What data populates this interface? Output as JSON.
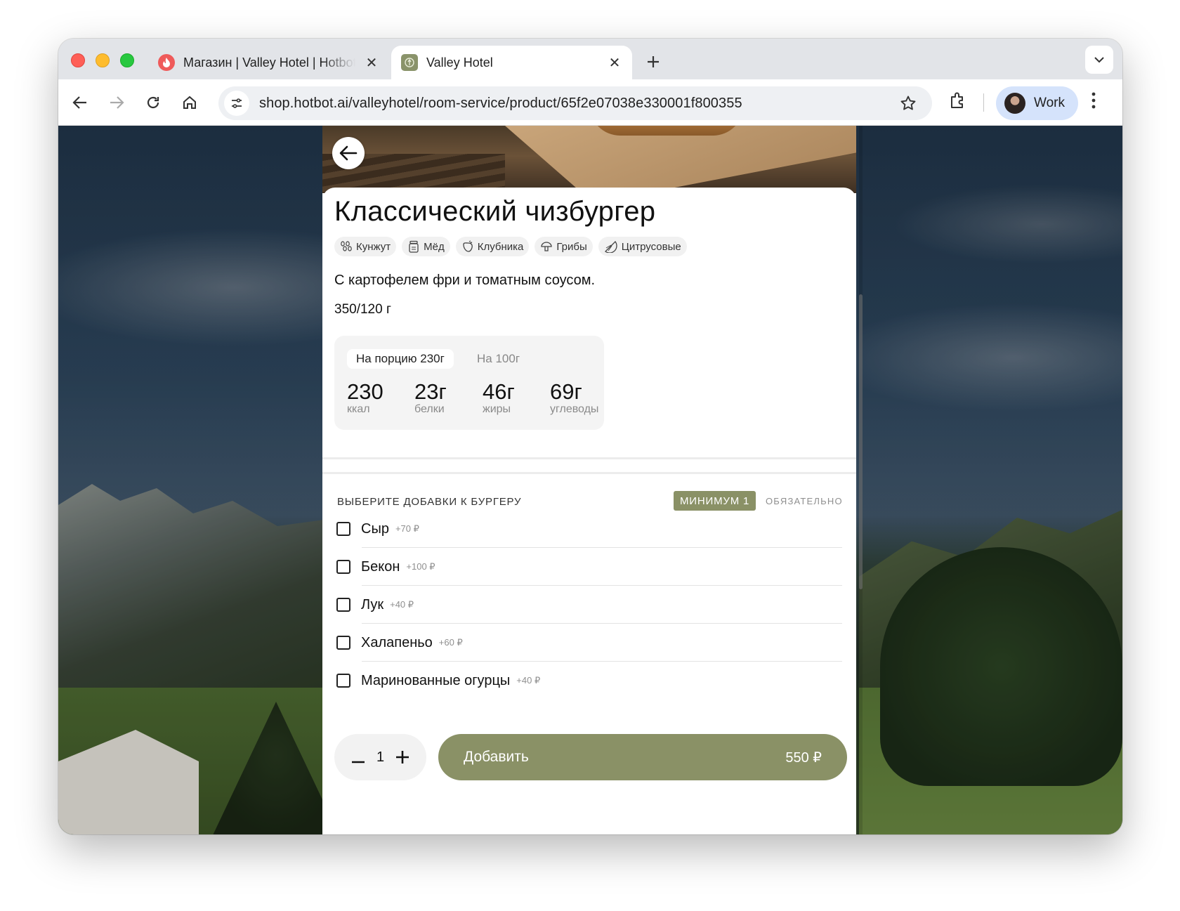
{
  "browser": {
    "tabs": [
      {
        "title": "Магазин | Valley Hotel | Hotbot",
        "favicon": "hotbot-flame-icon",
        "active": false
      },
      {
        "title": "Valley Hotel",
        "favicon": "valley-hotel-icon",
        "active": true
      }
    ],
    "url": "shop.hotbot.ai/valleyhotel/room-service/product/65f2e07038e330001f800355",
    "profile_label": "Work"
  },
  "product": {
    "title": "Классический чизбургер",
    "allergens": [
      {
        "label": "Кунжут",
        "icon": "sesame-icon"
      },
      {
        "label": "Мёд",
        "icon": "honey-jar-icon"
      },
      {
        "label": "Клубника",
        "icon": "strawberry-icon"
      },
      {
        "label": "Грибы",
        "icon": "mushroom-icon"
      },
      {
        "label": "Цитрусовые",
        "icon": "citrus-icon"
      }
    ],
    "description": "С картофелем фри и томатным соусом.",
    "weight": "350/120 г",
    "nutrition": {
      "tab_active": "На порцию 230г",
      "tab_other": "На 100г",
      "values": [
        {
          "value": "230",
          "label": "ккал"
        },
        {
          "value": "23г",
          "label": "белки"
        },
        {
          "value": "46г",
          "label": "жиры"
        },
        {
          "value": "69г",
          "label": "углеводы"
        }
      ]
    }
  },
  "addons": {
    "heading": "ВЫБЕРИТЕ ДОБАВКИ К БУРГЕРУ",
    "min_badge": "МИНИМУМ 1",
    "required": "ОБЯЗАТЕЛЬНО",
    "options": [
      {
        "name": "Сыр",
        "price": "+70 ₽",
        "checked": false
      },
      {
        "name": "Бекон",
        "price": "+100 ₽",
        "checked": false
      },
      {
        "name": "Лук",
        "price": "+40 ₽",
        "checked": false
      },
      {
        "name": "Халапеньо",
        "price": "+60 ₽",
        "checked": false
      },
      {
        "name": "Маринованные огурцы",
        "price": "+40 ₽",
        "checked": false
      }
    ]
  },
  "cart": {
    "quantity": "1",
    "add_label": "Добавить",
    "price": "550 ₽"
  },
  "colors": {
    "accent": "#8a9166",
    "text": "#111111"
  }
}
